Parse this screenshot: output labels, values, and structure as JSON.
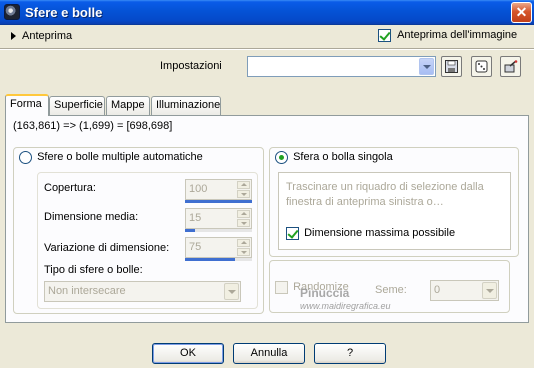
{
  "window": {
    "title": "Sfere e bolle",
    "close_glyph": "✕"
  },
  "preview": {
    "toggle_label": "Anteprima",
    "image_preview_label": "Anteprima dell'immagine",
    "image_preview_checked": true
  },
  "settings": {
    "label": "Impostazioni",
    "value": ""
  },
  "toolbar": {
    "save_icon": "save-icon",
    "dice_icon": "random-icon",
    "reset_icon": "reset-icon"
  },
  "tabs": [
    {
      "label": "Forma",
      "active": true
    },
    {
      "label": "Superficie",
      "active": false
    },
    {
      "label": "Mappe",
      "active": false
    },
    {
      "label": "Illuminazione",
      "active": false
    }
  ],
  "coords": "(163,861) => (1,699) = [698,698]",
  "auto_group": {
    "radio_label": "Sfere o bolle multiple automatiche",
    "selected": false,
    "coverage_label": "Copertura:",
    "coverage_value": "100",
    "coverage_level": 1.0,
    "mean_size_label": "Dimensione media:",
    "mean_size_value": "15",
    "mean_size_level": 0.15,
    "size_var_label": "Variazione di dimensione:",
    "size_var_value": "75",
    "size_var_level": 0.75,
    "type_label": "Tipo di sfere o bolle:",
    "type_value": "Non intersecare"
  },
  "single_group": {
    "radio_label": "Sfera o bolla singola",
    "selected": true,
    "hint": "Trascinare un riquadro di selezione dalla finestra di anteprima sinistra o…",
    "max_size_label": "Dimensione massima possibile",
    "max_size_checked": true
  },
  "random": {
    "randomize_label": "Randomize",
    "seed_label": "Seme:",
    "seed_value": "0"
  },
  "watermark": {
    "name": "Pinuccia",
    "url": "www.maidiregrafica.eu"
  },
  "buttons": {
    "ok": "OK",
    "cancel": "Annulla",
    "help": "?"
  }
}
